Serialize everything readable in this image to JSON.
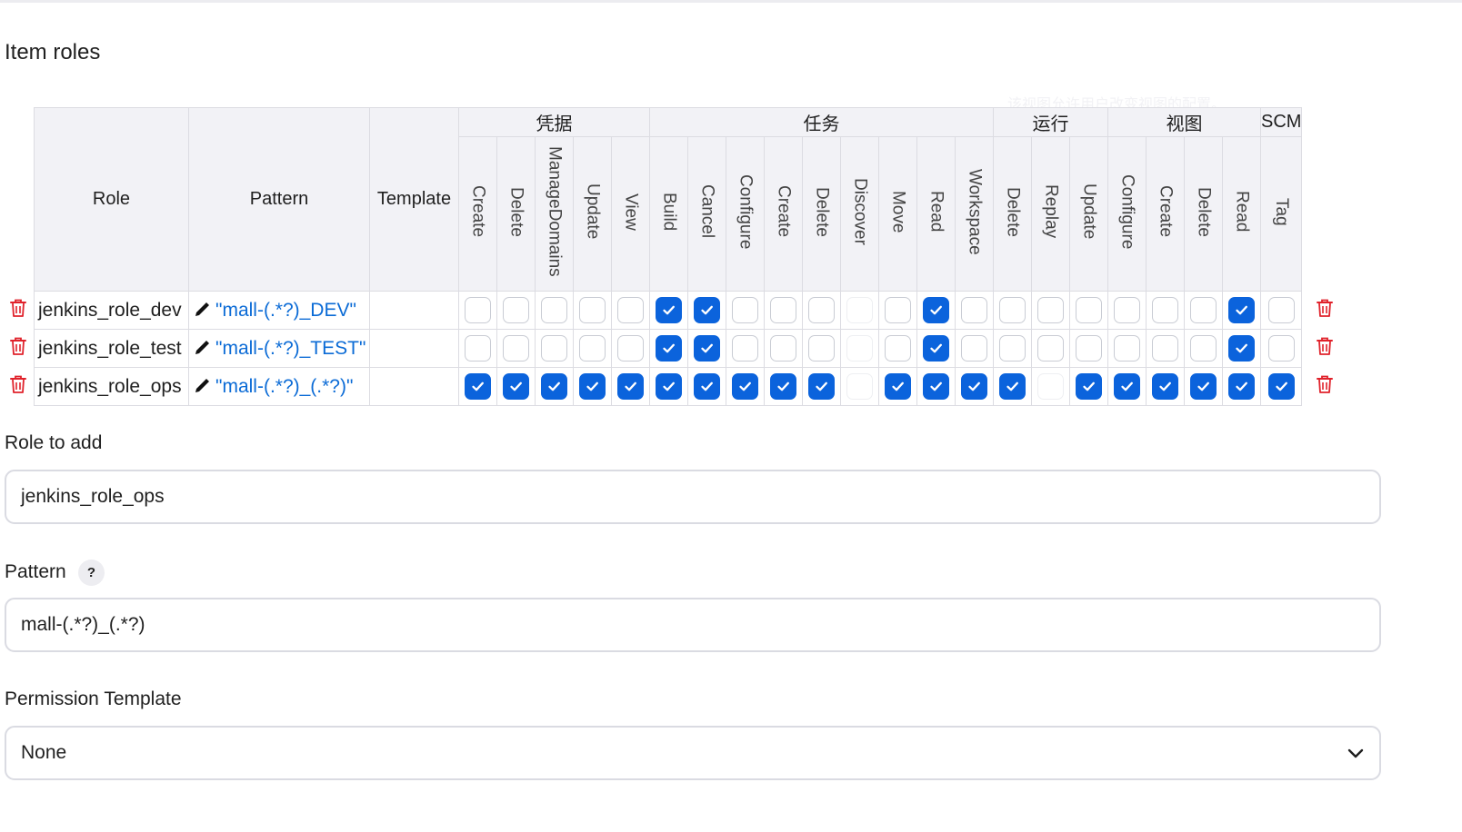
{
  "section_title": "Item roles",
  "table": {
    "headers": {
      "role": "Role",
      "pattern": "Pattern",
      "template": "Template"
    },
    "groups": [
      {
        "name": "凭据",
        "permissions": [
          "Create",
          "Delete",
          "ManageDomains",
          "Update",
          "View"
        ]
      },
      {
        "name": "任务",
        "permissions": [
          "Build",
          "Cancel",
          "Configure",
          "Create",
          "Delete",
          "Discover",
          "Move",
          "Read",
          "Workspace"
        ]
      },
      {
        "name": "运行",
        "permissions": [
          "Delete",
          "Replay",
          "Update"
        ]
      },
      {
        "name": "视图",
        "permissions": [
          "Configure",
          "Create",
          "Delete",
          "Read"
        ]
      },
      {
        "name": "SCM",
        "permissions": [
          "Tag"
        ]
      }
    ],
    "rows": [
      {
        "role": "jenkins_role_dev",
        "pattern": "\"mall-(.*?)_DEV\"",
        "perms": [
          0,
          0,
          0,
          0,
          0,
          1,
          1,
          0,
          0,
          0,
          2,
          0,
          1,
          0,
          0,
          0,
          0,
          0,
          0,
          0,
          1,
          0
        ]
      },
      {
        "role": "jenkins_role_test",
        "pattern": "\"mall-(.*?)_TEST\"",
        "perms": [
          0,
          0,
          0,
          0,
          0,
          1,
          1,
          0,
          0,
          0,
          2,
          0,
          1,
          0,
          0,
          0,
          0,
          0,
          0,
          0,
          1,
          0
        ]
      },
      {
        "role": "jenkins_role_ops",
        "pattern": "\"mall-(.*?)_(.*?)\"",
        "perms": [
          1,
          1,
          1,
          1,
          1,
          1,
          1,
          1,
          1,
          1,
          2,
          1,
          1,
          1,
          1,
          2,
          1,
          1,
          1,
          1,
          1,
          1
        ]
      }
    ]
  },
  "form": {
    "role_to_add": {
      "label": "Role to add",
      "value": "jenkins_role_ops"
    },
    "pattern": {
      "label": "Pattern",
      "help": "?",
      "value": "mall-(.*?)_(.*?)"
    },
    "permission_template": {
      "label": "Permission Template",
      "value": "None"
    }
  },
  "colors": {
    "accent": "#0b63dc",
    "link": "#0b6bd6",
    "danger": "#e0222b"
  }
}
